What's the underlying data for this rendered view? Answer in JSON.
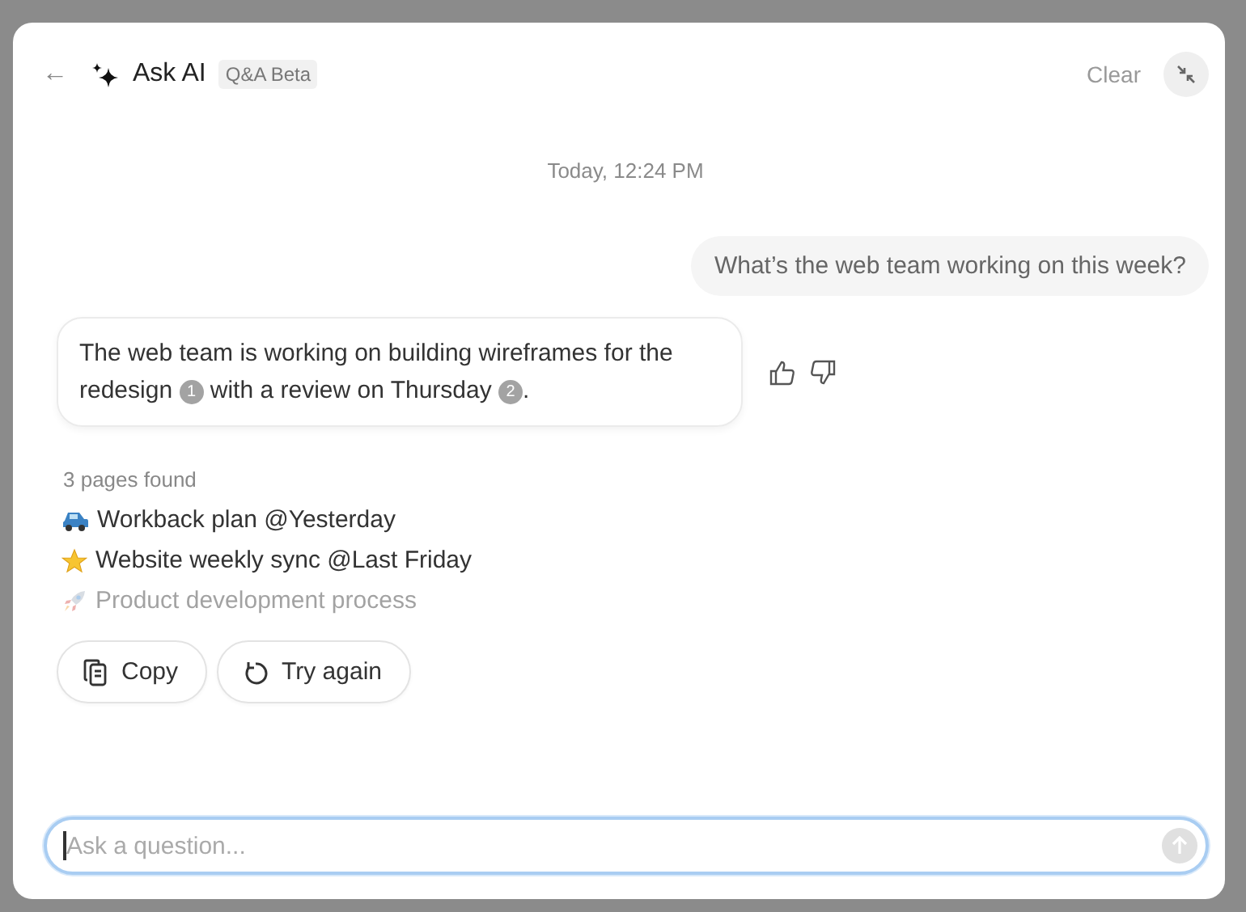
{
  "header": {
    "back": "←",
    "title": "Ask AI",
    "badge": "Q&A Beta",
    "clear": "Clear"
  },
  "timestamp": "Today, 12:24 PM",
  "question": "What’s the web team working on this week?",
  "answer": {
    "parts": [
      {
        "kind": "text",
        "text": "The web team is working on building wireframes for the redesign "
      },
      {
        "kind": "citation",
        "text": "1"
      },
      {
        "kind": "text",
        "text": " with a review on Thursday "
      },
      {
        "kind": "citation",
        "text": "2"
      },
      {
        "kind": "text",
        "text": "."
      }
    ]
  },
  "sources": {
    "summary": "3 pages found",
    "pages": [
      {
        "kind": "car",
        "title": "Workback plan @Yesterday",
        "faded": false
      },
      {
        "kind": "star",
        "title": "Website weekly sync @Last Friday",
        "faded": false
      },
      {
        "kind": "rocket",
        "title": "Product development process",
        "faded": true
      }
    ]
  },
  "actions": [
    {
      "kind": "copy",
      "label": "Copy"
    },
    {
      "kind": "retry",
      "label": "Try again"
    }
  ],
  "input": {
    "placeholder": "Ask a question...",
    "focused": true
  }
}
